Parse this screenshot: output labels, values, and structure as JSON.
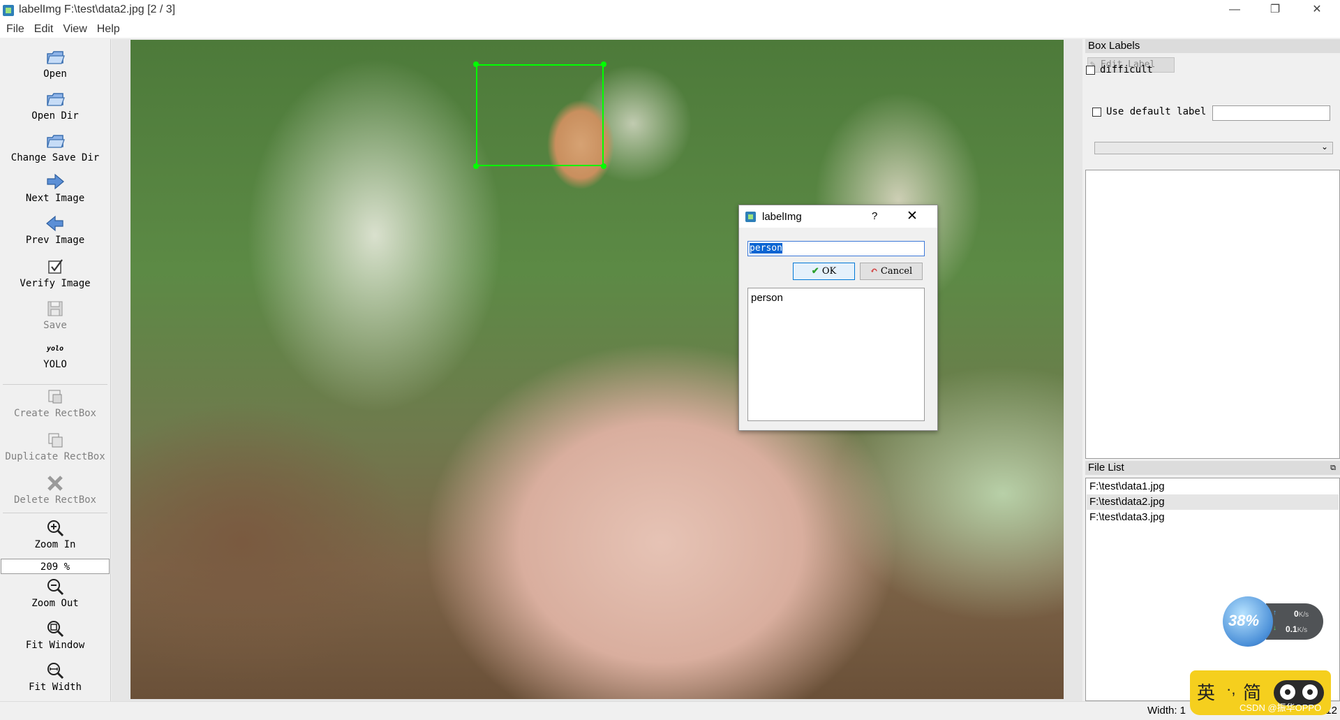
{
  "window": {
    "title": "labelImg F:\\test\\data2.jpg [2 / 3]",
    "controls": {
      "minimize": "—",
      "restore": "❐",
      "close": "✕"
    }
  },
  "menu": [
    "File",
    "Edit",
    "View",
    "Help"
  ],
  "toolbar": {
    "open": "Open",
    "open_dir": "Open Dir",
    "change_save_dir": "Change Save Dir",
    "next_image": "Next Image",
    "prev_image": "Prev Image",
    "verify_image": "Verify Image",
    "save": "Save",
    "yolo_icon_text": "yolo",
    "yolo": "YOLO",
    "create_rectbox": "Create RectBox",
    "duplicate_rectbox": "Duplicate RectBox",
    "delete_rectbox": "Delete RectBox",
    "zoom_in": "Zoom In",
    "zoom_value": "209 %",
    "zoom_out": "Zoom Out",
    "fit_window": "Fit Window",
    "fit_width": "Fit Width"
  },
  "dialog": {
    "title": "labelImg",
    "help": "?",
    "close": "✕",
    "input_value": "person",
    "ok_label": "OK",
    "cancel_label": "Cancel",
    "label_list": [
      "person"
    ]
  },
  "box_labels": {
    "header": "Box Labels",
    "edit_label": "Edit Label",
    "difficult": "difficult",
    "use_default_label": "Use default label",
    "default_label_value": ""
  },
  "file_list": {
    "header": "File List",
    "items": [
      "F:\\test\\data1.jpg",
      "F:\\test\\data2.jpg",
      "F:\\test\\data3.jpg"
    ],
    "selected_index": 1
  },
  "status": {
    "text": "Width: 1"
  },
  "overlays": {
    "net_percent": "38%",
    "upload_value": "0",
    "upload_unit": "K/s",
    "download_value": "0.1",
    "download_unit": "K/s",
    "ime_lang": "英",
    "ime_sep": "·,",
    "ime_script": "简",
    "watermark": "CSDN @振华OPPO",
    "status_tail": "12"
  },
  "colors": {
    "bbox": "#00ff00",
    "selection": "#0a64d2",
    "accent": "#0078d7"
  }
}
